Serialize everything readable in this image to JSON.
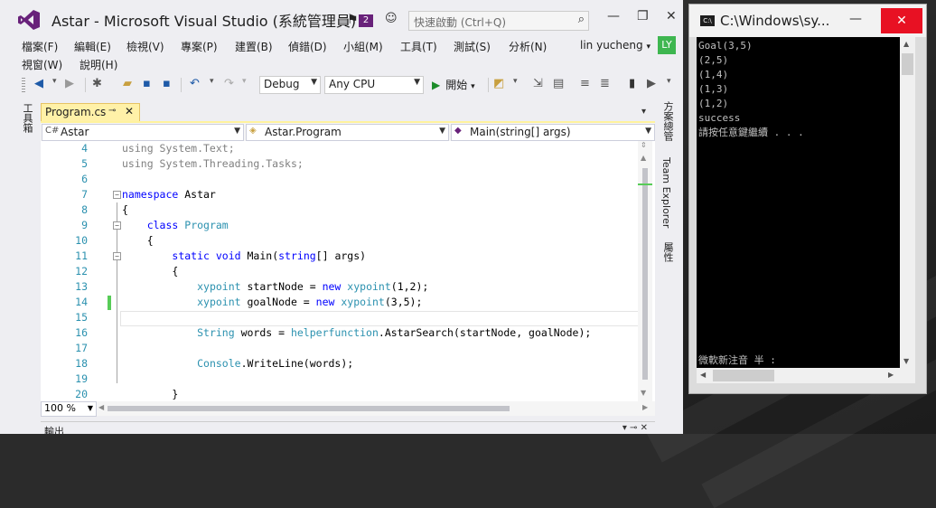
{
  "vs": {
    "title": "Astar - Microsoft Visual Studio (系統管理員)",
    "notification_count": "2",
    "quick_launch_placeholder": "快速啟動 (Ctrl+Q)",
    "menu": [
      "檔案(F)",
      "編輯(E)",
      "檢視(V)",
      "專案(P)",
      "建置(B)",
      "偵錯(D)",
      "小組(M)",
      "工具(T)",
      "測試(S)",
      "分析(N)",
      "視窗(W)",
      "說明(H)"
    ],
    "user_name": "lin yucheng",
    "user_initials": "LY",
    "toolbar": {
      "config": "Debug",
      "platform": "Any CPU",
      "start_label": "開始"
    },
    "left_sidebar_label": "工具箱",
    "right_sidebar": [
      "方案總管",
      "Team Explorer",
      "屬性"
    ],
    "document_tab": "Program.cs",
    "nav": {
      "project": "Astar",
      "class": "Astar.Program",
      "member": "Main(string[] args)"
    },
    "code_lines": [
      {
        "n": "4",
        "parts": [
          {
            "t": "using",
            "c": "gray"
          },
          {
            "t": " System.Text;",
            "c": "gray"
          }
        ]
      },
      {
        "n": "5",
        "parts": [
          {
            "t": "using",
            "c": "gray"
          },
          {
            "t": " System.Threading.Tasks;",
            "c": "gray"
          }
        ]
      },
      {
        "n": "6",
        "parts": []
      },
      {
        "n": "7",
        "parts": [
          {
            "t": "namespace",
            "c": "kw"
          },
          {
            "t": " Astar",
            "c": ""
          }
        ]
      },
      {
        "n": "8",
        "parts": [
          {
            "t": "{",
            "c": ""
          }
        ]
      },
      {
        "n": "9",
        "parts": [
          {
            "t": "    ",
            "c": ""
          },
          {
            "t": "class",
            "c": "kw"
          },
          {
            "t": " ",
            "c": ""
          },
          {
            "t": "Program",
            "c": "ty"
          }
        ]
      },
      {
        "n": "10",
        "parts": [
          {
            "t": "    {",
            "c": ""
          }
        ]
      },
      {
        "n": "11",
        "parts": [
          {
            "t": "        ",
            "c": ""
          },
          {
            "t": "static",
            "c": "kw"
          },
          {
            "t": " ",
            "c": ""
          },
          {
            "t": "void",
            "c": "kw"
          },
          {
            "t": " Main(",
            "c": ""
          },
          {
            "t": "string",
            "c": "kw"
          },
          {
            "t": "[] args)",
            "c": ""
          }
        ]
      },
      {
        "n": "12",
        "parts": [
          {
            "t": "        {",
            "c": ""
          }
        ]
      },
      {
        "n": "13",
        "parts": [
          {
            "t": "            ",
            "c": ""
          },
          {
            "t": "xypoint",
            "c": "ty"
          },
          {
            "t": " startNode = ",
            "c": ""
          },
          {
            "t": "new",
            "c": "kw"
          },
          {
            "t": " ",
            "c": ""
          },
          {
            "t": "xypoint",
            "c": "ty"
          },
          {
            "t": "(1,2);",
            "c": ""
          }
        ]
      },
      {
        "n": "14",
        "parts": [
          {
            "t": "            ",
            "c": ""
          },
          {
            "t": "xypoint",
            "c": "ty"
          },
          {
            "t": " goalNode = ",
            "c": ""
          },
          {
            "t": "new",
            "c": "kw"
          },
          {
            "t": " ",
            "c": ""
          },
          {
            "t": "xypoint",
            "c": "ty"
          },
          {
            "t": "(3,5);",
            "c": ""
          }
        ]
      },
      {
        "n": "15",
        "parts": []
      },
      {
        "n": "16",
        "parts": [
          {
            "t": "            ",
            "c": ""
          },
          {
            "t": "String",
            "c": "ty"
          },
          {
            "t": " words = ",
            "c": ""
          },
          {
            "t": "helperfunction",
            "c": "ty"
          },
          {
            "t": ".AstarSearch(startNode, goalNode);",
            "c": ""
          }
        ]
      },
      {
        "n": "17",
        "parts": []
      },
      {
        "n": "18",
        "parts": [
          {
            "t": "            ",
            "c": ""
          },
          {
            "t": "Console",
            "c": "ty"
          },
          {
            "t": ".WriteLine(words);",
            "c": ""
          }
        ]
      },
      {
        "n": "19",
        "parts": []
      },
      {
        "n": "20",
        "parts": [
          {
            "t": "        }",
            "c": ""
          }
        ]
      }
    ],
    "zoom": "100 %",
    "output_tab": "輸出"
  },
  "console": {
    "title": "C:\\Windows\\sy...",
    "lines": [
      "Goal(3,5)",
      "(2,5)",
      "(1,4)",
      "(1,3)",
      "(1,2)",
      "success",
      "請按任意鍵繼續 . . ."
    ],
    "ime_status": "微軟新注音 半 :"
  },
  "colors": {
    "vs_purple": "#68217a",
    "tab_yellow": "#fff1a8",
    "keyword_blue": "#0000ff",
    "type_teal": "#2b91af",
    "change_green": "#57cc57",
    "close_red": "#e81123"
  }
}
